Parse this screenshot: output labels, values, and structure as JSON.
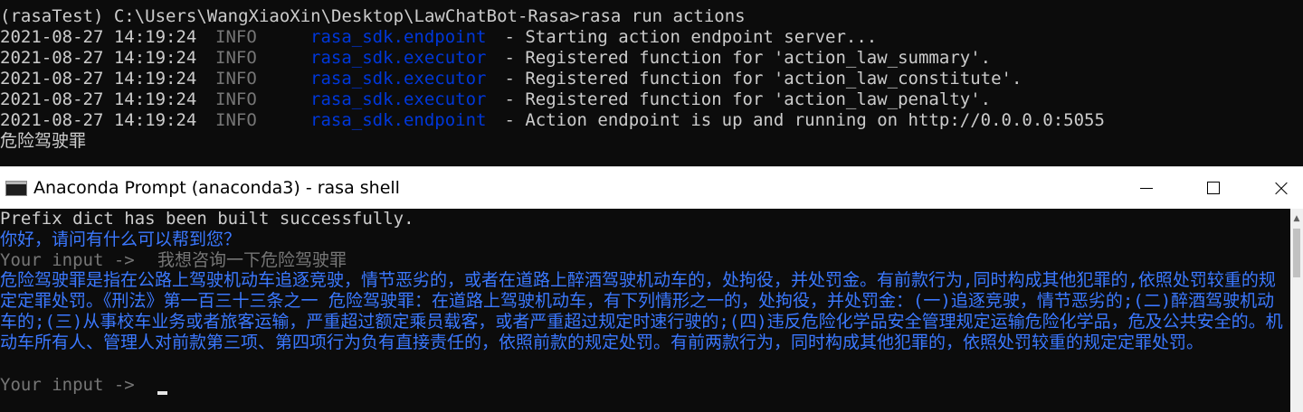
{
  "top_terminal": {
    "command_line": "(rasaTest) C:\\Users\\WangXiaoXin\\Desktop\\LawChatBot-Rasa>rasa run actions",
    "logs": [
      {
        "timestamp": "2021-08-27 14:19:24",
        "level": "INFO",
        "logger": "rasa_sdk.endpoint",
        "message": " - Starting action endpoint server..."
      },
      {
        "timestamp": "2021-08-27 14:19:24",
        "level": "INFO",
        "logger": "rasa_sdk.executor",
        "message": " - Registered function for 'action_law_summary'."
      },
      {
        "timestamp": "2021-08-27 14:19:24",
        "level": "INFO",
        "logger": "rasa_sdk.executor",
        "message": " - Registered function for 'action_law_constitute'."
      },
      {
        "timestamp": "2021-08-27 14:19:24",
        "level": "INFO",
        "logger": "rasa_sdk.executor",
        "message": " - Registered function for 'action_law_penalty'."
      },
      {
        "timestamp": "2021-08-27 14:19:24",
        "level": "INFO",
        "logger": "rasa_sdk.endpoint",
        "message": " - Action endpoint is up and running on http://0.0.0.0:5055"
      }
    ],
    "last_line": "危险驾驶罪"
  },
  "window": {
    "title": "Anaconda Prompt (anaconda3) - rasa  shell",
    "icon": "console-icon"
  },
  "bottom_terminal": {
    "prefix_line": "Prefix dict has been built successfully.",
    "greeting": "你好，请问有什么可以帮到您？",
    "input_prompt_1": "Your input ->  ",
    "user_message": "我想咨询一下危险驾驶罪",
    "bot_response": "危险驾驶罪是指在公路上驾驶机动车追逐竞驶，情节恶劣的，或者在道路上醉酒驾驶机动车的，处拘役，并处罚金。有前款行为,同时构成其他犯罪的,依照处罚较重的规定定罪处罚。《刑法》第一百三十三条之一 危险驾驶罪：在道路上驾驶机动车，有下列情形之一的，处拘役，并处罚金：(一)追逐竞驶，情节恶劣的;(二)醉酒驾驶机动车的;(三)从事校车业务或者旅客运输，严重超过额定乘员载客，或者严重超过规定时速行驶的;(四)违反危险化学品安全管理规定运输危险化学品，危及公共安全的。机动车所有人、管理人对前款第三项、第四项行为负有直接责任的，依照前款的规定处罚。有前两款行为，同时构成其他犯罪的，依照处罚较重的规定定罪处罚。",
    "input_prompt_2": "Your input -> "
  },
  "colors": {
    "background": "#0c0c0c",
    "default_text": "#cccccc",
    "info_level": "#767676",
    "logger_name": "#0037da",
    "bot_text": "#3b78ff"
  }
}
